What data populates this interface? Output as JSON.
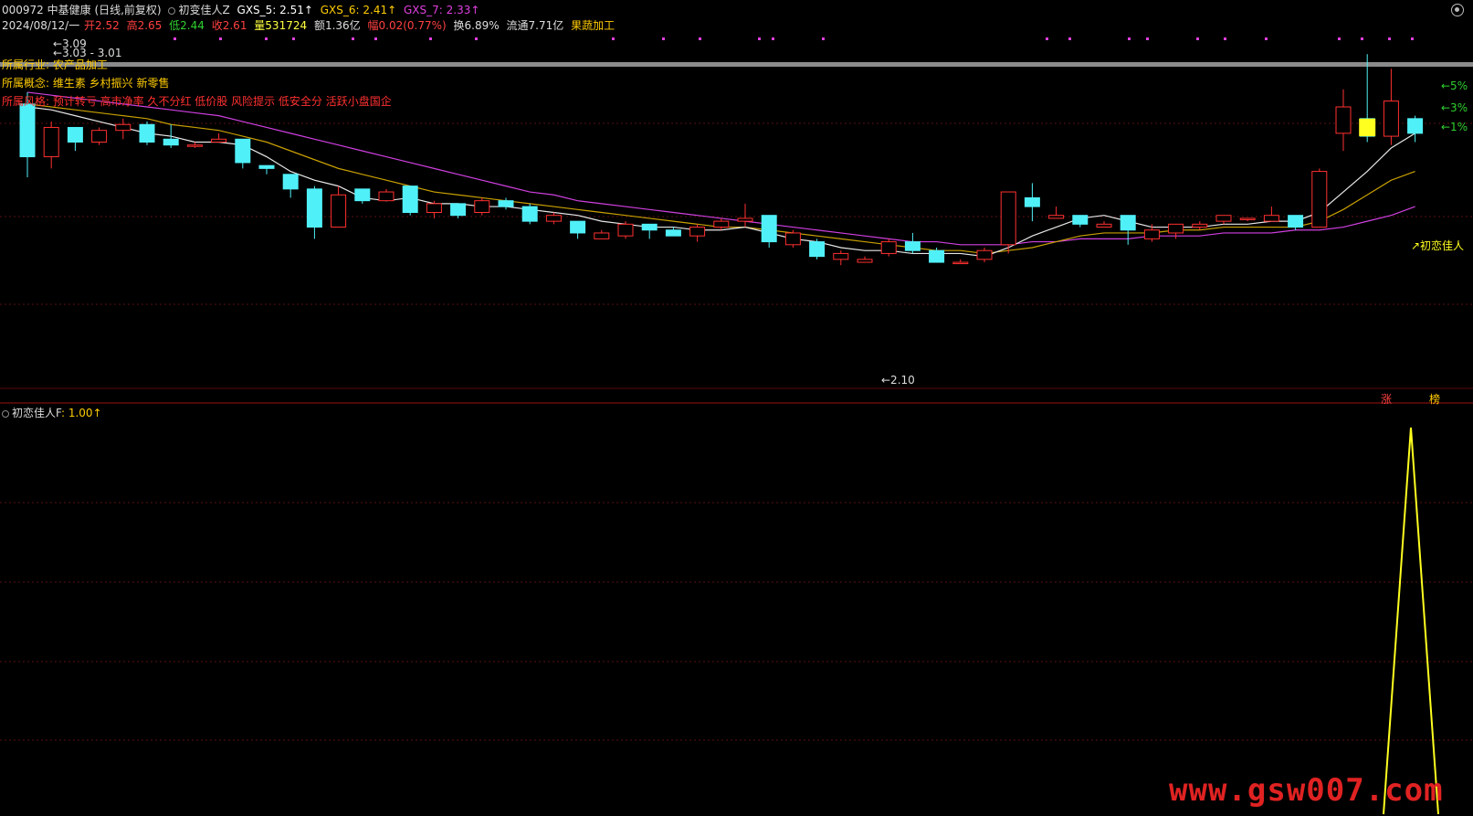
{
  "header": {
    "code_name": "000972 中基健康 (日线,前复权)",
    "indicator_name": "初变佳人Z",
    "gxs5": "GXS_5: 2.51↑",
    "gxs6": "GXS_6: 2.41↑",
    "gxs7": "GXS_7: 2.33↑",
    "colors": {
      "gxs5": "#ffffff",
      "gxs6": "#ffcc00",
      "gxs7": "#e040e0"
    }
  },
  "quote": {
    "date": "2024/08/12/一",
    "open": "开2.52",
    "high": "高2.65",
    "low": "低2.44",
    "close": "收2.61",
    "volume": "量531724",
    "amount": "额1.36亿",
    "change": "幅0.02(0.77%)",
    "turnover": "换6.89%",
    "float": "流通7.71亿",
    "sector": "果蔬加工"
  },
  "annotations": {
    "industry": "所属行业: 农产品加工",
    "concept": "所属概念: 维生素 乡村振兴 新零售",
    "style": "所属风格: 预计转亏 高市净率 久不分红 低价股 风险提示 低安全分 活跃小盘国企"
  },
  "price_labels": {
    "high_309": "←3.09",
    "mid_303": "←3.03 - 3.01",
    "low_210": "←2.10",
    "pct5": "←5%",
    "pct3": "←3%",
    "pct1": "←1%",
    "signal": "初恋佳人"
  },
  "badges": {
    "zhang": "涨",
    "bang": "榜"
  },
  "sub_panel": {
    "indicator": "初恋佳人F",
    "value": ": 1.00↑"
  },
  "watermark": "www.gsw007.com",
  "chart_data": {
    "type": "candlestick",
    "candles": [
      [
        3.05,
        2.87,
        3.09,
        2.8
      ],
      [
        2.87,
        2.97,
        2.99,
        2.83
      ],
      [
        2.97,
        2.92,
        2.97,
        2.89
      ],
      [
        2.92,
        2.96,
        2.97,
        2.91
      ],
      [
        2.96,
        2.98,
        3.0,
        2.93
      ],
      [
        2.98,
        2.92,
        2.99,
        2.91
      ],
      [
        2.93,
        2.91,
        2.98,
        2.9
      ],
      [
        2.91,
        2.91,
        2.92,
        2.9
      ],
      [
        2.92,
        2.93,
        2.95,
        2.92
      ],
      [
        2.93,
        2.85,
        2.93,
        2.83
      ],
      [
        2.84,
        2.83,
        2.84,
        2.81
      ],
      [
        2.81,
        2.76,
        2.81,
        2.73
      ],
      [
        2.76,
        2.63,
        2.77,
        2.59
      ],
      [
        2.63,
        2.74,
        2.77,
        2.63
      ],
      [
        2.76,
        2.72,
        2.76,
        2.71
      ],
      [
        2.72,
        2.75,
        2.76,
        2.73
      ],
      [
        2.77,
        2.68,
        2.77,
        2.67
      ],
      [
        2.68,
        2.71,
        2.72,
        2.66
      ],
      [
        2.71,
        2.67,
        2.71,
        2.66
      ],
      [
        2.68,
        2.72,
        2.73,
        2.67
      ],
      [
        2.72,
        2.7,
        2.73,
        2.69
      ],
      [
        2.7,
        2.65,
        2.71,
        2.64
      ],
      [
        2.65,
        2.67,
        2.68,
        2.64
      ],
      [
        2.65,
        2.61,
        2.65,
        2.59
      ],
      [
        2.59,
        2.61,
        2.62,
        2.59
      ],
      [
        2.6,
        2.64,
        2.65,
        2.59
      ],
      [
        2.64,
        2.62,
        2.64,
        2.59
      ],
      [
        2.62,
        2.6,
        2.63,
        2.6
      ],
      [
        2.6,
        2.63,
        2.64,
        2.58
      ],
      [
        2.63,
        2.65,
        2.66,
        2.62
      ],
      [
        2.65,
        2.66,
        2.71,
        2.63
      ],
      [
        2.67,
        2.58,
        2.67,
        2.56
      ],
      [
        2.57,
        2.61,
        2.62,
        2.56
      ],
      [
        2.58,
        2.53,
        2.59,
        2.52
      ],
      [
        2.52,
        2.54,
        2.55,
        2.5
      ],
      [
        2.51,
        2.52,
        2.53,
        2.51
      ],
      [
        2.54,
        2.58,
        2.59,
        2.53
      ],
      [
        2.58,
        2.55,
        2.61,
        2.54
      ],
      [
        2.55,
        2.51,
        2.56,
        2.52
      ],
      [
        2.51,
        2.51,
        2.52,
        2.51
      ],
      [
        2.52,
        2.55,
        2.56,
        2.51
      ],
      [
        2.57,
        2.75,
        2.75,
        2.54
      ],
      [
        2.73,
        2.7,
        2.78,
        2.65
      ],
      [
        2.66,
        2.67,
        2.7,
        2.67
      ],
      [
        2.67,
        2.64,
        2.66,
        2.63
      ],
      [
        2.63,
        2.64,
        2.65,
        2.63
      ],
      [
        2.67,
        2.62,
        2.67,
        2.57
      ],
      [
        2.59,
        2.62,
        2.64,
        2.58
      ],
      [
        2.61,
        2.64,
        2.64,
        2.59
      ],
      [
        2.63,
        2.64,
        2.65,
        2.62
      ],
      [
        2.65,
        2.67,
        2.67,
        2.64
      ],
      [
        2.66,
        2.66,
        2.66,
        2.65
      ],
      [
        2.65,
        2.67,
        2.7,
        2.66
      ],
      [
        2.67,
        2.63,
        2.67,
        2.62
      ],
      [
        2.63,
        2.82,
        2.83,
        2.63
      ],
      [
        2.95,
        3.04,
        3.1,
        2.89
      ],
      [
        3.0,
        2.94,
        3.22,
        2.92
      ],
      [
        2.94,
        3.06,
        3.17,
        2.91
      ],
      [
        3.0,
        2.95,
        3.01,
        2.92
      ]
    ],
    "ma_white": [
      3.04,
      3.03,
      3.01,
      2.99,
      2.97,
      2.95,
      2.94,
      2.92,
      2.92,
      2.91,
      2.87,
      2.82,
      2.79,
      2.77,
      2.73,
      2.72,
      2.73,
      2.71,
      2.71,
      2.7,
      2.7,
      2.69,
      2.68,
      2.67,
      2.65,
      2.64,
      2.63,
      2.63,
      2.62,
      2.62,
      2.63,
      2.61,
      2.59,
      2.58,
      2.56,
      2.55,
      2.55,
      2.54,
      2.54,
      2.54,
      2.53,
      2.56,
      2.6,
      2.63,
      2.66,
      2.67,
      2.65,
      2.63,
      2.63,
      2.63,
      2.64,
      2.64,
      2.65,
      2.65,
      2.68,
      2.75,
      2.82,
      2.9,
      2.95
    ],
    "ma_yellow": [
      3.05,
      3.04,
      3.03,
      3.02,
      3.01,
      3.0,
      2.98,
      2.97,
      2.96,
      2.94,
      2.92,
      2.89,
      2.86,
      2.83,
      2.81,
      2.79,
      2.77,
      2.75,
      2.74,
      2.73,
      2.72,
      2.71,
      2.7,
      2.69,
      2.68,
      2.67,
      2.66,
      2.65,
      2.64,
      2.63,
      2.63,
      2.62,
      2.61,
      2.6,
      2.59,
      2.58,
      2.57,
      2.56,
      2.55,
      2.55,
      2.54,
      2.55,
      2.56,
      2.58,
      2.6,
      2.61,
      2.61,
      2.61,
      2.62,
      2.62,
      2.63,
      2.63,
      2.63,
      2.63,
      2.65,
      2.69,
      2.74,
      2.79,
      2.82
    ],
    "ma_purple": [
      3.09,
      3.08,
      3.07,
      3.06,
      3.05,
      3.04,
      3.03,
      3.02,
      3.01,
      2.99,
      2.97,
      2.95,
      2.93,
      2.91,
      2.89,
      2.87,
      2.85,
      2.83,
      2.81,
      2.79,
      2.77,
      2.75,
      2.74,
      2.72,
      2.71,
      2.7,
      2.69,
      2.68,
      2.67,
      2.66,
      2.65,
      2.64,
      2.63,
      2.62,
      2.61,
      2.6,
      2.59,
      2.58,
      2.58,
      2.57,
      2.57,
      2.57,
      2.58,
      2.58,
      2.59,
      2.59,
      2.59,
      2.6,
      2.6,
      2.6,
      2.61,
      2.61,
      2.61,
      2.62,
      2.62,
      2.63,
      2.65,
      2.67,
      2.7
    ],
    "signal_dots_x": [
      190,
      240,
      290,
      320,
      385,
      410,
      470,
      520,
      670,
      725,
      765,
      830,
      845,
      900,
      1145,
      1170,
      1235,
      1255,
      1310,
      1340,
      1385,
      1465,
      1490,
      1520,
      1545
    ],
    "sub_line": {
      "x": [
        1515,
        1545,
        1575
      ],
      "y": [
        0,
        1,
        0
      ]
    }
  }
}
